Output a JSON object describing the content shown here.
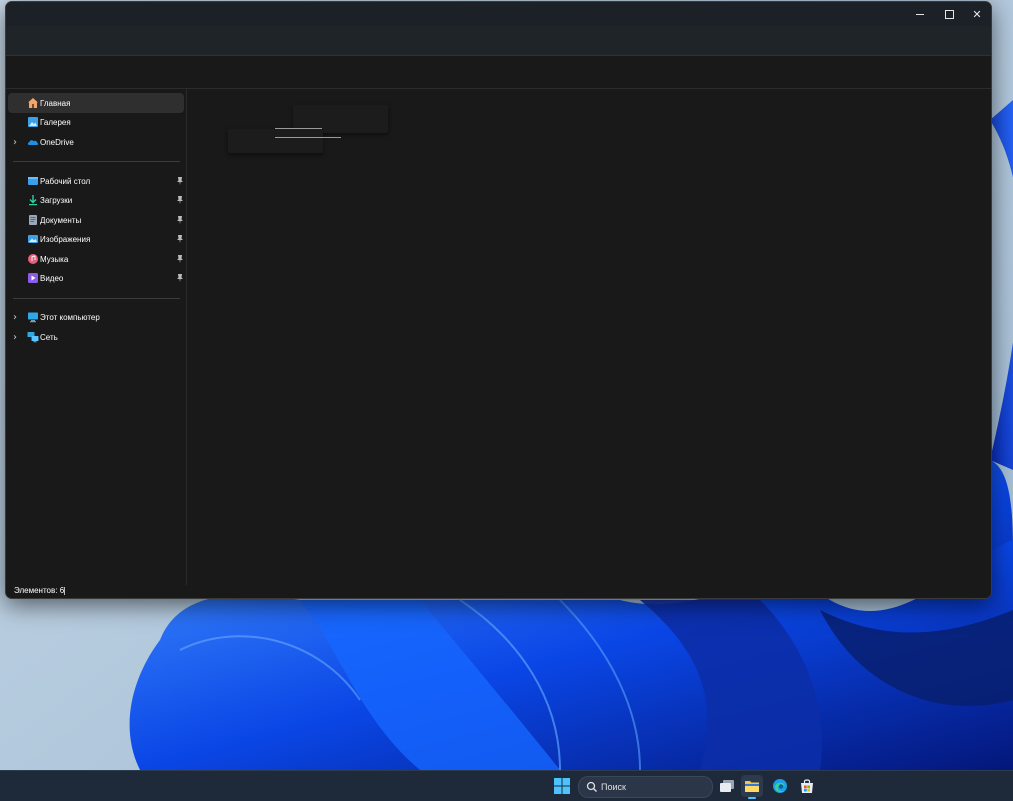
{
  "window": {
    "controls": {
      "minimize": "—",
      "maximize": "□",
      "close": "✕"
    }
  },
  "sidebar": {
    "items": [
      {
        "label": "Главная",
        "icon": "home-icon",
        "selected": true
      },
      {
        "label": "Галерея",
        "icon": "gallery-icon"
      },
      {
        "label": "OneDrive",
        "icon": "onedrive-icon",
        "expandable": true
      },
      {
        "label": "Рабочий стол",
        "icon": "desktop-folder-icon",
        "pinned": true
      },
      {
        "label": "Загрузки",
        "icon": "downloads-icon",
        "pinned": true
      },
      {
        "label": "Документы",
        "icon": "documents-icon",
        "pinned": true
      },
      {
        "label": "Изображения",
        "icon": "pictures-icon",
        "pinned": true
      },
      {
        "label": "Музыка",
        "icon": "music-icon",
        "pinned": true
      },
      {
        "label": "Видео",
        "icon": "videos-icon",
        "pinned": true
      },
      {
        "label": "Этот компьютер",
        "icon": "this-pc-icon",
        "expandable": true
      },
      {
        "label": "Сеть",
        "icon": "network-icon",
        "expandable": true
      }
    ]
  },
  "status": {
    "items_count": "Элементов: 6"
  },
  "taskbar": {
    "search_placeholder": "Поиск",
    "apps": [
      "start-icon",
      "task-view-icon",
      "file-explorer-icon",
      "edge-icon",
      "store-icon"
    ]
  },
  "colors": {
    "accent": "#4cc2ff",
    "window_bg": "#191919",
    "selected_bg": "#2f2f2f",
    "taskbar_bg": "#1e2a3a"
  }
}
